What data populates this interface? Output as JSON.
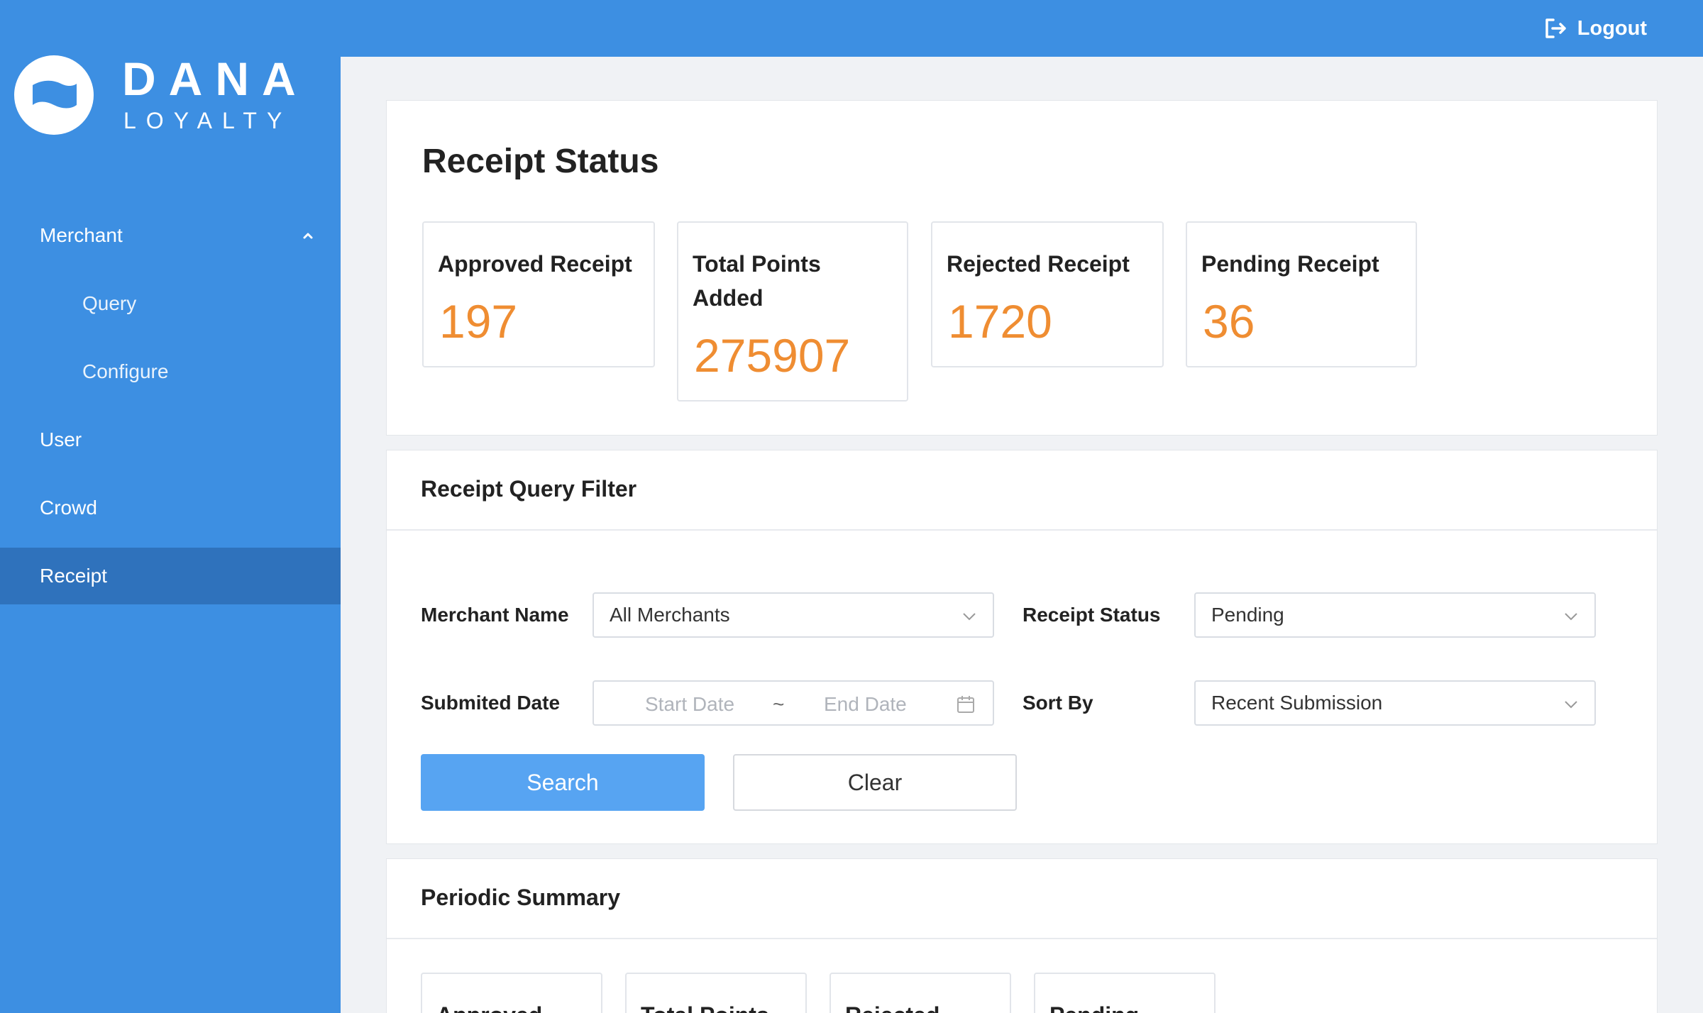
{
  "header": {
    "logout_label": "Logout"
  },
  "brand": {
    "name": "DANA",
    "sub": "LOYALTY"
  },
  "sidebar": {
    "items": [
      {
        "label": "Merchant"
      },
      {
        "label": "Query"
      },
      {
        "label": "Configure"
      },
      {
        "label": "User"
      },
      {
        "label": "Crowd"
      },
      {
        "label": "Receipt",
        "active": true
      }
    ]
  },
  "receipt_status": {
    "title": "Receipt Status",
    "stats": [
      {
        "label": "Approved Receipt",
        "value": "197"
      },
      {
        "label": "Total Points Added",
        "value": "275907"
      },
      {
        "label": "Rejected Receipt",
        "value": "1720"
      },
      {
        "label": "Pending Receipt",
        "value": "36"
      }
    ]
  },
  "filter": {
    "title": "Receipt Query Filter",
    "merchant_label": "Merchant Name",
    "merchant_value": "All Merchants",
    "status_label": "Receipt Status",
    "status_value": "Pending",
    "date_label": "Submited Date",
    "start_placeholder": "Start Date",
    "date_separator": "~",
    "end_placeholder": "End Date",
    "sort_label": "Sort By",
    "sort_value": "Recent Submission",
    "search_label": "Search",
    "clear_label": "Clear"
  },
  "periodic": {
    "title": "Periodic Summary",
    "cards": [
      "Approved",
      "Total Points",
      "Rejected",
      "Pending"
    ]
  },
  "colors": {
    "primary": "#3d8fe2",
    "active": "#2f72bc",
    "accent": "#ef8d32",
    "button": "#57a4f2"
  }
}
